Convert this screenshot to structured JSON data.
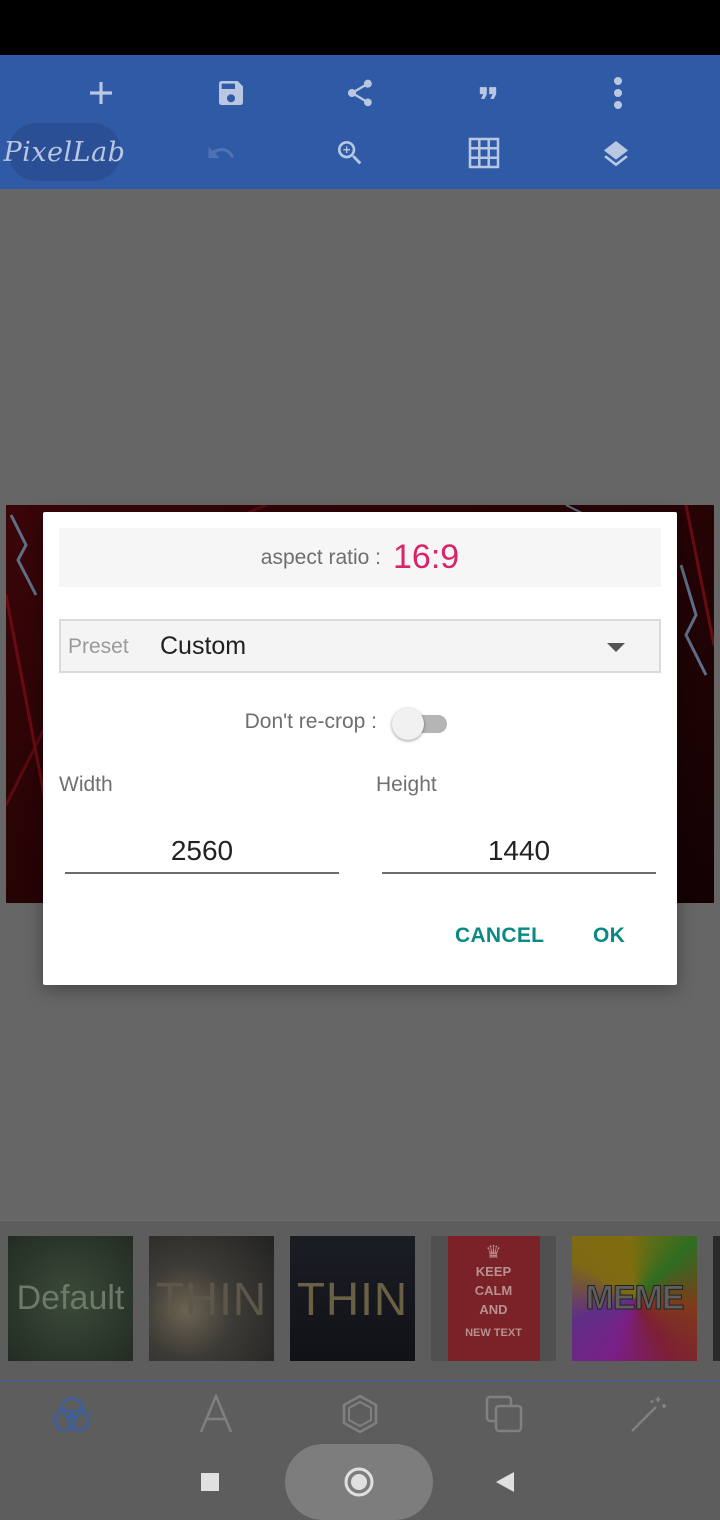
{
  "app": {
    "logo": "PixelLab",
    "toolbar_icons": [
      "add-icon",
      "save-icon",
      "share-icon",
      "quote-icon",
      "more-vert-icon",
      "undo-icon",
      "zoom-in-icon",
      "grid-icon",
      "layers-icon"
    ]
  },
  "dialog": {
    "aspect_ratio_label": "aspect ratio :",
    "aspect_ratio_value": "16:9",
    "preset_label": "Preset",
    "preset_value": "Custom",
    "recrop_label": "Don't re-crop :",
    "recrop_enabled": false,
    "width_label": "Width",
    "width_value": "2560",
    "height_label": "Height",
    "height_value": "1440",
    "cancel_label": "CANCEL",
    "ok_label": "OK"
  },
  "templates": [
    {
      "label": "Default"
    },
    {
      "label": "THIN"
    },
    {
      "label": "THIN"
    },
    {
      "label": "KEEP CALM AND",
      "sub": "NEW TEXT"
    },
    {
      "label": "MEME"
    }
  ],
  "bottom_tabs": [
    "filters-icon",
    "text-icon",
    "shape-icon",
    "layers-copy-icon",
    "effects-icon"
  ],
  "nav": [
    "recents-icon",
    "home-icon",
    "back-icon"
  ],
  "colors": {
    "toolbar": "#2f5aa6",
    "accent_pink": "#d8246a",
    "button_teal": "#0a8a82"
  }
}
